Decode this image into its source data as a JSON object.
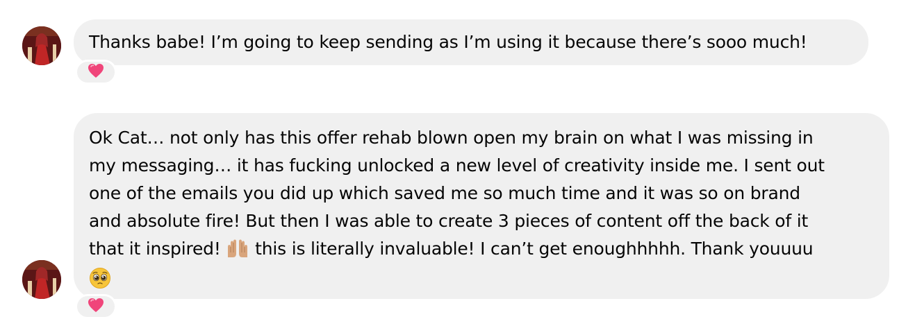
{
  "messages": [
    {
      "text": "Thanks babe! I’m going to keep sending as I’m using it because there’s sooo much!",
      "reaction": "heart"
    },
    {
      "line1": "Ok Cat… not only has this offer rehab blown open my brain on what I was missing in",
      "line2": "my messaging… it has fucking unlocked a new level of creativity inside me. I sent out",
      "line3": "one of the emails you did up which saved me so much time and it was so on brand",
      "line4": "and absolute fire! But then I was able to create 3 pieces of content off the back of it",
      "line5_a": "that it inspired!",
      "line5_b": "this is literally invaluable! I can’t get enoughhhhh. Thank youuuu",
      "reaction": "heart"
    }
  ],
  "colors": {
    "bubble_bg": "#f0f0f0",
    "heart": "#f0457a"
  },
  "icons": [
    "avatar",
    "heart-reaction-icon",
    "raising-hands-emoji-icon",
    "pleading-face-emoji-icon"
  ]
}
